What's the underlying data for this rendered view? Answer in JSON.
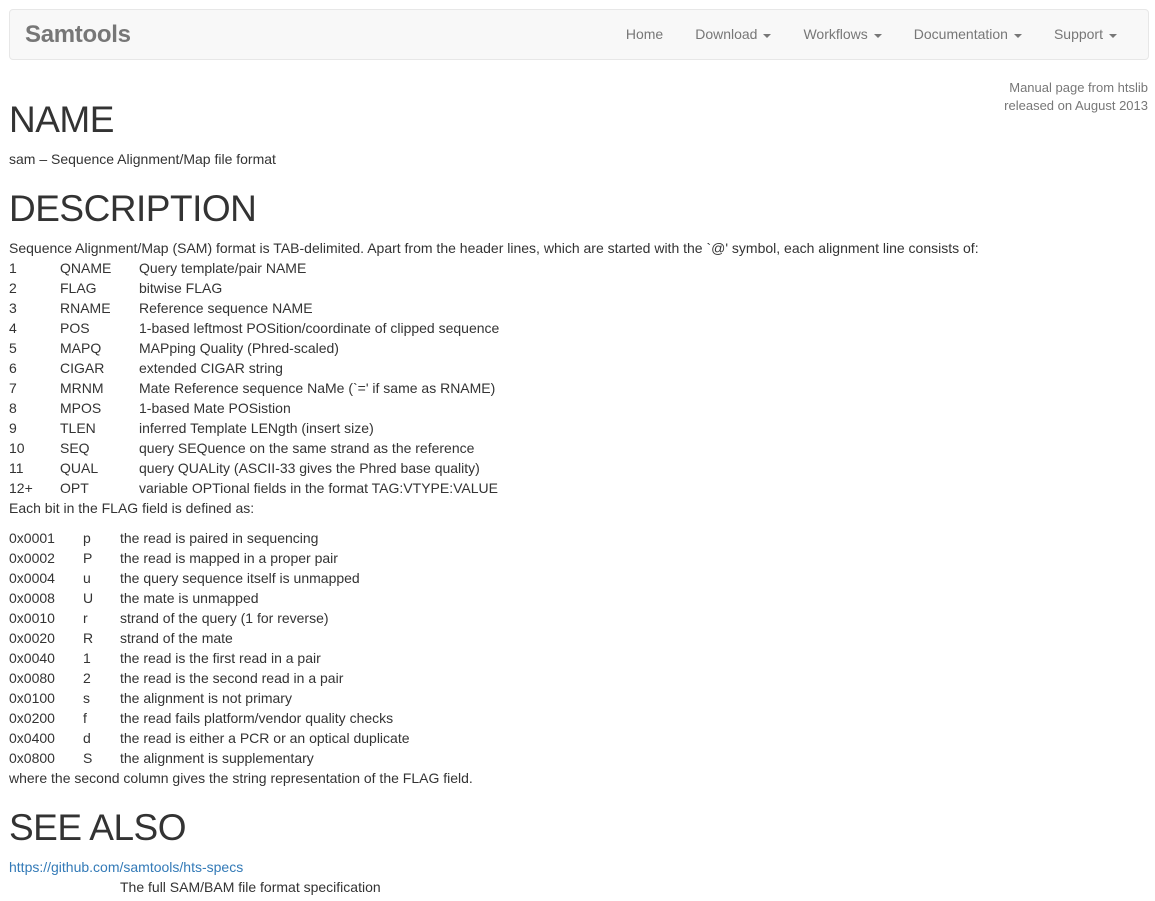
{
  "navbar": {
    "brand": "Samtools",
    "items": [
      {
        "label": "Home",
        "dropdown": false
      },
      {
        "label": "Download",
        "dropdown": true
      },
      {
        "label": "Workflows",
        "dropdown": true
      },
      {
        "label": "Documentation",
        "dropdown": true
      },
      {
        "label": "Support",
        "dropdown": true
      }
    ]
  },
  "release": {
    "line1": "Manual page from htslib",
    "line2": "released on August 2013"
  },
  "name_section": {
    "heading": "NAME",
    "text": "sam – Sequence Alignment/Map file format"
  },
  "description": {
    "heading": "DESCRIPTION",
    "intro": "Sequence Alignment/Map (SAM) format is TAB-delimited. Apart from the header lines, which are started with the `@' symbol, each alignment line consists of:",
    "fields": [
      {
        "col": "1",
        "name": "QNAME",
        "desc": "Query template/pair NAME"
      },
      {
        "col": "2",
        "name": "FLAG",
        "desc": "bitwise FLAG"
      },
      {
        "col": "3",
        "name": "RNAME",
        "desc": "Reference sequence NAME"
      },
      {
        "col": "4",
        "name": "POS",
        "desc": "1-based leftmost POSition/coordinate of clipped sequence"
      },
      {
        "col": "5",
        "name": "MAPQ",
        "desc": "MAPping Quality (Phred-scaled)"
      },
      {
        "col": "6",
        "name": "CIGAR",
        "desc": "extended CIGAR string"
      },
      {
        "col": "7",
        "name": "MRNM",
        "desc": "Mate Reference sequence NaMe (`=' if same as RNAME)"
      },
      {
        "col": "8",
        "name": "MPOS",
        "desc": "1-based Mate POSistion"
      },
      {
        "col": "9",
        "name": "TLEN",
        "desc": "inferred Template LENgth (insert size)"
      },
      {
        "col": "10",
        "name": "SEQ",
        "desc": "query SEQuence on the same strand as the reference"
      },
      {
        "col": "11",
        "name": "QUAL",
        "desc": "query QUALity (ASCII-33 gives the Phred base quality)"
      },
      {
        "col": "12+",
        "name": "OPT",
        "desc": "variable OPTional fields in the format TAG:VTYPE:VALUE"
      }
    ],
    "flag_intro": "Each bit in the FLAG field is defined as:",
    "flags": [
      {
        "hex": "0x0001",
        "char": "p",
        "desc": "the read is paired in sequencing"
      },
      {
        "hex": "0x0002",
        "char": "P",
        "desc": "the read is mapped in a proper pair"
      },
      {
        "hex": "0x0004",
        "char": "u",
        "desc": "the query sequence itself is unmapped"
      },
      {
        "hex": "0x0008",
        "char": "U",
        "desc": "the mate is unmapped"
      },
      {
        "hex": "0x0010",
        "char": "r",
        "desc": "strand of the query (1 for reverse)"
      },
      {
        "hex": "0x0020",
        "char": "R",
        "desc": "strand of the mate"
      },
      {
        "hex": "0x0040",
        "char": "1",
        "desc": "the read is the first read in a pair"
      },
      {
        "hex": "0x0080",
        "char": "2",
        "desc": "the read is the second read in a pair"
      },
      {
        "hex": "0x0100",
        "char": "s",
        "desc": "the alignment is not primary"
      },
      {
        "hex": "0x0200",
        "char": "f",
        "desc": "the read fails platform/vendor quality checks"
      },
      {
        "hex": "0x0400",
        "char": "d",
        "desc": "the read is either a PCR or an optical duplicate"
      },
      {
        "hex": "0x0800",
        "char": "S",
        "desc": "the alignment is supplementary"
      }
    ],
    "flag_outro": "where the second column gives the string representation of the FLAG field."
  },
  "see_also": {
    "heading": "SEE ALSO",
    "link_text": "https://github.com/samtools/hts-specs",
    "link_desc": "The full SAM/BAM file format specification"
  }
}
